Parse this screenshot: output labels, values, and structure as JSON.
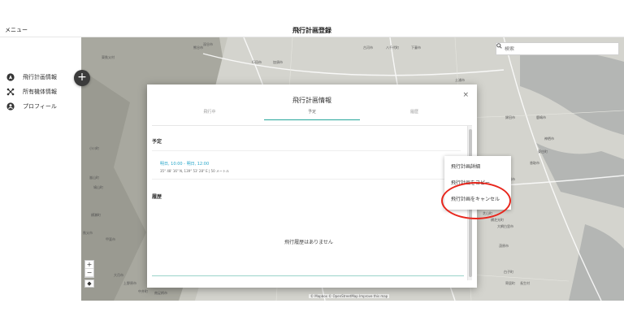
{
  "header": {
    "menu_label": "メニュー",
    "title": "飛行計画登録"
  },
  "sidebar": {
    "items": [
      {
        "label": "飛行計画情報",
        "icon": "navigation-icon"
      },
      {
        "label": "所有機体情報",
        "icon": "drone-icon"
      },
      {
        "label": "プロフィール",
        "icon": "account-icon"
      }
    ]
  },
  "map": {
    "search_placeholder": "検索",
    "attribution": "© Mapbox © OpenStreetMap  Improve this map",
    "zoom_in": "+",
    "zoom_out": "−",
    "place_labels": [
      "深谷市",
      "熊谷市",
      "行田市",
      "加須市",
      "古河市",
      "八千代町",
      "下妻市",
      "つくば市",
      "土浦市",
      "鉾田市",
      "鹿嶋市",
      "神栖市",
      "東庄町",
      "香取市",
      "成田市",
      "多古町",
      "芝山町",
      "横芝光町",
      "大網白里市",
      "茂原市",
      "白子町",
      "寄居町",
      "東秩父村",
      "小川町",
      "嵐山町",
      "鳩山町",
      "横瀬町",
      "秩父市",
      "甲斐市",
      "大月市",
      "上野原市",
      "中井町",
      "南足柄市",
      "箱根町",
      "長生村"
    ]
  },
  "fab": {
    "label": "+"
  },
  "dialog": {
    "title": "飛行計画情報",
    "close": "×",
    "tabs": [
      "飛行中",
      "予定",
      "履歴"
    ],
    "plan_section": "予定",
    "plan_time": "明日, 10:00 - 明日, 12:00",
    "plan_coord": "35° 48' 16\" N, 139° 53' 28\" E | 50 メートル",
    "history_section": "履歴",
    "empty_message": "飛行履歴はありません"
  },
  "context_menu": {
    "items": [
      "飛行計画詳細",
      "飛行計画をコピー",
      "飛行計画をキャンセル"
    ]
  },
  "colors": {
    "accent": "#26a69a",
    "time_link": "#26a6c9",
    "highlight": "#e8261c"
  }
}
